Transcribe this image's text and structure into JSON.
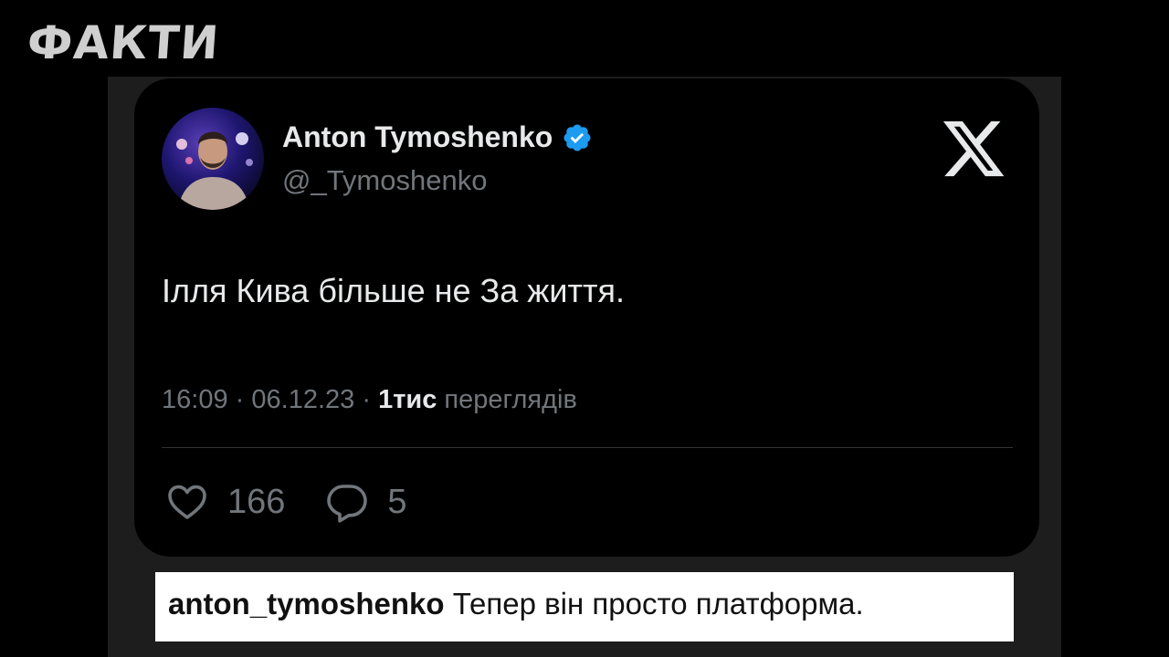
{
  "watermark": {
    "logo_text": "ФАКТИ"
  },
  "tweet": {
    "author_name": "Anton Tymoshenko",
    "verified": true,
    "handle": "@_Tymoshenko",
    "text": "Ілля Кива більше не За життя.",
    "time": "16:09",
    "separator": "·",
    "date": "06.12.23",
    "views_count": "1тис",
    "views_label": "переглядів",
    "likes": "166",
    "replies": "5",
    "platform_icon": "x-logo-icon"
  },
  "caption": {
    "username": "anton_tymoshenko",
    "text": "Тепер він просто платформа."
  },
  "colors": {
    "background": "#000000",
    "frame": "#1d1d1d",
    "text_primary": "#e7e9ea",
    "text_secondary": "#71767b",
    "verified_badge": "#1d9bf0",
    "caption_background": "#ffffff"
  }
}
